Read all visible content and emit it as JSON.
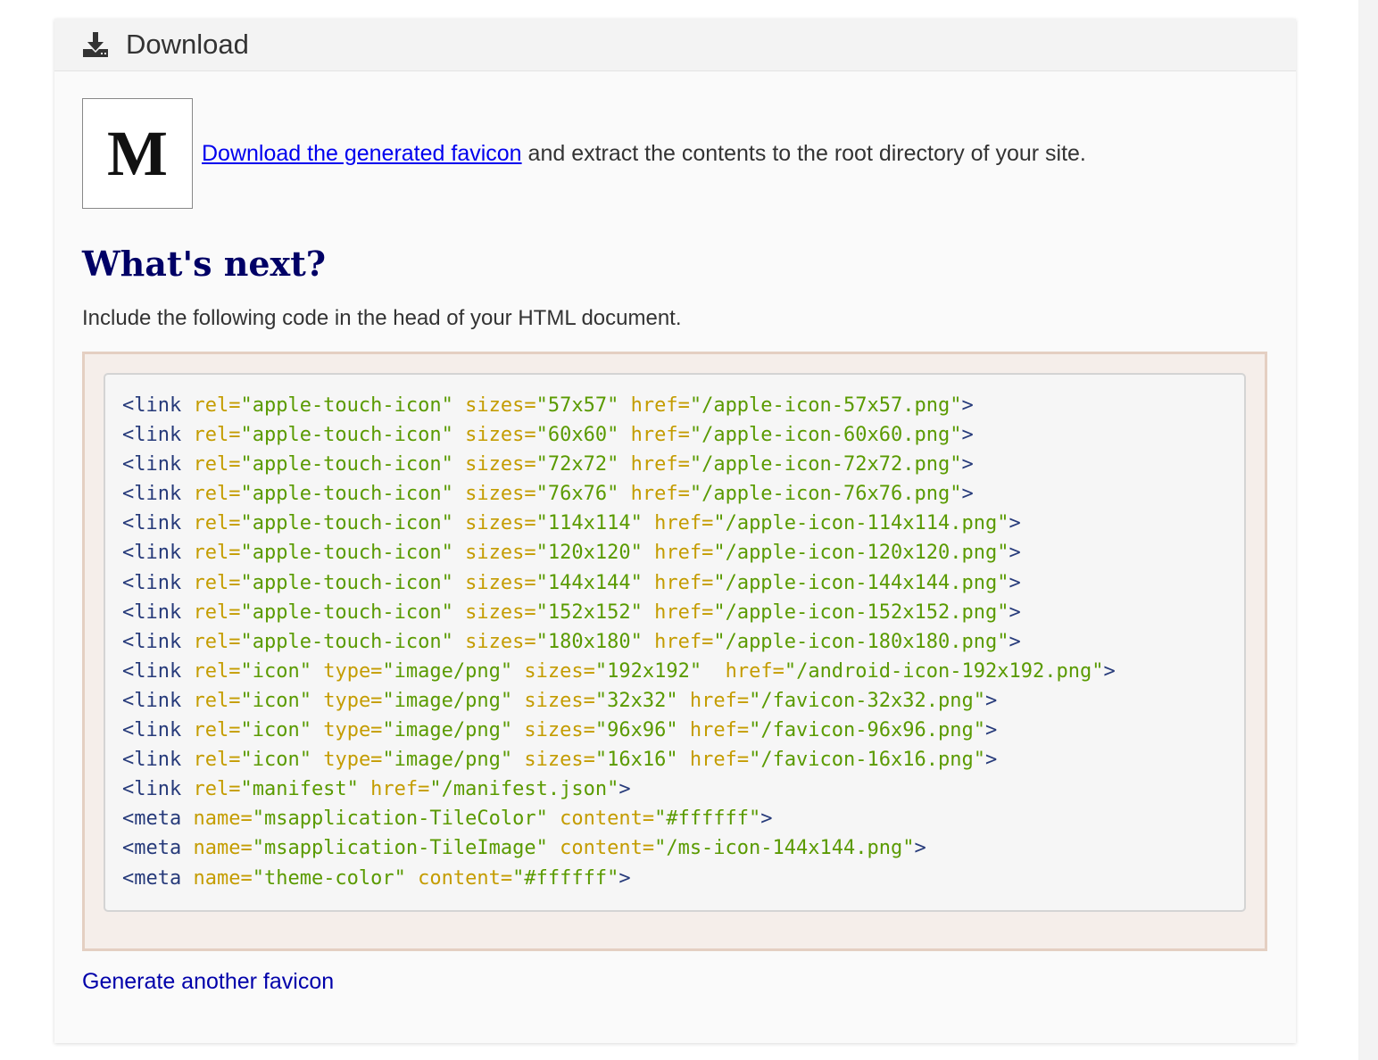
{
  "header": {
    "icon": "download-icon",
    "title": "Download"
  },
  "preview": {
    "letter": "M"
  },
  "intro": {
    "link_text": "Download the generated favicon",
    "rest_text": " and extract the contents to the root directory of your site."
  },
  "whats_next": {
    "heading": "What's next?",
    "instruction": "Include the following code in the head of your HTML document."
  },
  "code": {
    "lines": [
      [
        [
          "tag",
          "<link "
        ],
        [
          "attr",
          "rel="
        ],
        [
          "val",
          "\"apple-touch-icon\""
        ],
        [
          "plain",
          " "
        ],
        [
          "attr",
          "sizes="
        ],
        [
          "val",
          "\"57x57\""
        ],
        [
          "plain",
          " "
        ],
        [
          "attr",
          "href="
        ],
        [
          "val",
          "\"/apple-icon-57x57.png\""
        ],
        [
          "tag",
          ">"
        ]
      ],
      [
        [
          "tag",
          "<link "
        ],
        [
          "attr",
          "rel="
        ],
        [
          "val",
          "\"apple-touch-icon\""
        ],
        [
          "plain",
          " "
        ],
        [
          "attr",
          "sizes="
        ],
        [
          "val",
          "\"60x60\""
        ],
        [
          "plain",
          " "
        ],
        [
          "attr",
          "href="
        ],
        [
          "val",
          "\"/apple-icon-60x60.png\""
        ],
        [
          "tag",
          ">"
        ]
      ],
      [
        [
          "tag",
          "<link "
        ],
        [
          "attr",
          "rel="
        ],
        [
          "val",
          "\"apple-touch-icon\""
        ],
        [
          "plain",
          " "
        ],
        [
          "attr",
          "sizes="
        ],
        [
          "val",
          "\"72x72\""
        ],
        [
          "plain",
          " "
        ],
        [
          "attr",
          "href="
        ],
        [
          "val",
          "\"/apple-icon-72x72.png\""
        ],
        [
          "tag",
          ">"
        ]
      ],
      [
        [
          "tag",
          "<link "
        ],
        [
          "attr",
          "rel="
        ],
        [
          "val",
          "\"apple-touch-icon\""
        ],
        [
          "plain",
          " "
        ],
        [
          "attr",
          "sizes="
        ],
        [
          "val",
          "\"76x76\""
        ],
        [
          "plain",
          " "
        ],
        [
          "attr",
          "href="
        ],
        [
          "val",
          "\"/apple-icon-76x76.png\""
        ],
        [
          "tag",
          ">"
        ]
      ],
      [
        [
          "tag",
          "<link "
        ],
        [
          "attr",
          "rel="
        ],
        [
          "val",
          "\"apple-touch-icon\""
        ],
        [
          "plain",
          " "
        ],
        [
          "attr",
          "sizes="
        ],
        [
          "val",
          "\"114x114\""
        ],
        [
          "plain",
          " "
        ],
        [
          "attr",
          "href="
        ],
        [
          "val",
          "\"/apple-icon-114x114.png\""
        ],
        [
          "tag",
          ">"
        ]
      ],
      [
        [
          "tag",
          "<link "
        ],
        [
          "attr",
          "rel="
        ],
        [
          "val",
          "\"apple-touch-icon\""
        ],
        [
          "plain",
          " "
        ],
        [
          "attr",
          "sizes="
        ],
        [
          "val",
          "\"120x120\""
        ],
        [
          "plain",
          " "
        ],
        [
          "attr",
          "href="
        ],
        [
          "val",
          "\"/apple-icon-120x120.png\""
        ],
        [
          "tag",
          ">"
        ]
      ],
      [
        [
          "tag",
          "<link "
        ],
        [
          "attr",
          "rel="
        ],
        [
          "val",
          "\"apple-touch-icon\""
        ],
        [
          "plain",
          " "
        ],
        [
          "attr",
          "sizes="
        ],
        [
          "val",
          "\"144x144\""
        ],
        [
          "plain",
          " "
        ],
        [
          "attr",
          "href="
        ],
        [
          "val",
          "\"/apple-icon-144x144.png\""
        ],
        [
          "tag",
          ">"
        ]
      ],
      [
        [
          "tag",
          "<link "
        ],
        [
          "attr",
          "rel="
        ],
        [
          "val",
          "\"apple-touch-icon\""
        ],
        [
          "plain",
          " "
        ],
        [
          "attr",
          "sizes="
        ],
        [
          "val",
          "\"152x152\""
        ],
        [
          "plain",
          " "
        ],
        [
          "attr",
          "href="
        ],
        [
          "val",
          "\"/apple-icon-152x152.png\""
        ],
        [
          "tag",
          ">"
        ]
      ],
      [
        [
          "tag",
          "<link "
        ],
        [
          "attr",
          "rel="
        ],
        [
          "val",
          "\"apple-touch-icon\""
        ],
        [
          "plain",
          " "
        ],
        [
          "attr",
          "sizes="
        ],
        [
          "val",
          "\"180x180\""
        ],
        [
          "plain",
          " "
        ],
        [
          "attr",
          "href="
        ],
        [
          "val",
          "\"/apple-icon-180x180.png\""
        ],
        [
          "tag",
          ">"
        ]
      ],
      [
        [
          "tag",
          "<link "
        ],
        [
          "attr",
          "rel="
        ],
        [
          "val",
          "\"icon\""
        ],
        [
          "plain",
          " "
        ],
        [
          "attr",
          "type="
        ],
        [
          "val",
          "\"image/png\""
        ],
        [
          "plain",
          " "
        ],
        [
          "attr",
          "sizes="
        ],
        [
          "val",
          "\"192x192\""
        ],
        [
          "plain",
          "  "
        ],
        [
          "attr",
          "href="
        ],
        [
          "val",
          "\"/android-icon-192x192.png\""
        ],
        [
          "tag",
          ">"
        ]
      ],
      [
        [
          "tag",
          "<link "
        ],
        [
          "attr",
          "rel="
        ],
        [
          "val",
          "\"icon\""
        ],
        [
          "plain",
          " "
        ],
        [
          "attr",
          "type="
        ],
        [
          "val",
          "\"image/png\""
        ],
        [
          "plain",
          " "
        ],
        [
          "attr",
          "sizes="
        ],
        [
          "val",
          "\"32x32\""
        ],
        [
          "plain",
          " "
        ],
        [
          "attr",
          "href="
        ],
        [
          "val",
          "\"/favicon-32x32.png\""
        ],
        [
          "tag",
          ">"
        ]
      ],
      [
        [
          "tag",
          "<link "
        ],
        [
          "attr",
          "rel="
        ],
        [
          "val",
          "\"icon\""
        ],
        [
          "plain",
          " "
        ],
        [
          "attr",
          "type="
        ],
        [
          "val",
          "\"image/png\""
        ],
        [
          "plain",
          " "
        ],
        [
          "attr",
          "sizes="
        ],
        [
          "val",
          "\"96x96\""
        ],
        [
          "plain",
          " "
        ],
        [
          "attr",
          "href="
        ],
        [
          "val",
          "\"/favicon-96x96.png\""
        ],
        [
          "tag",
          ">"
        ]
      ],
      [
        [
          "tag",
          "<link "
        ],
        [
          "attr",
          "rel="
        ],
        [
          "val",
          "\"icon\""
        ],
        [
          "plain",
          " "
        ],
        [
          "attr",
          "type="
        ],
        [
          "val",
          "\"image/png\""
        ],
        [
          "plain",
          " "
        ],
        [
          "attr",
          "sizes="
        ],
        [
          "val",
          "\"16x16\""
        ],
        [
          "plain",
          " "
        ],
        [
          "attr",
          "href="
        ],
        [
          "val",
          "\"/favicon-16x16.png\""
        ],
        [
          "tag",
          ">"
        ]
      ],
      [
        [
          "tag",
          "<link "
        ],
        [
          "attr",
          "rel="
        ],
        [
          "val",
          "\"manifest\""
        ],
        [
          "plain",
          " "
        ],
        [
          "attr",
          "href="
        ],
        [
          "val",
          "\"/manifest.json\""
        ],
        [
          "tag",
          ">"
        ]
      ],
      [
        [
          "tag",
          "<meta "
        ],
        [
          "attr",
          "name="
        ],
        [
          "val",
          "\"msapplication-TileColor\""
        ],
        [
          "plain",
          " "
        ],
        [
          "attr",
          "content="
        ],
        [
          "val",
          "\"#ffffff\""
        ],
        [
          "tag",
          ">"
        ]
      ],
      [
        [
          "tag",
          "<meta "
        ],
        [
          "attr",
          "name="
        ],
        [
          "val",
          "\"msapplication-TileImage\""
        ],
        [
          "plain",
          " "
        ],
        [
          "attr",
          "content="
        ],
        [
          "val",
          "\"/ms-icon-144x144.png\""
        ],
        [
          "tag",
          ">"
        ]
      ],
      [
        [
          "tag",
          "<meta "
        ],
        [
          "attr",
          "name="
        ],
        [
          "val",
          "\"theme-color\""
        ],
        [
          "plain",
          " "
        ],
        [
          "attr",
          "content="
        ],
        [
          "val",
          "\"#ffffff\""
        ],
        [
          "tag",
          ">"
        ]
      ]
    ]
  },
  "footer": {
    "generate_link": "Generate another favicon"
  },
  "colors": {
    "heading": "#000066",
    "link": "#0000ee",
    "code_tag": "#263a7a",
    "code_attr": "#c49c00",
    "code_value": "#5a9a00",
    "code_frame": "#e4cfc2"
  }
}
